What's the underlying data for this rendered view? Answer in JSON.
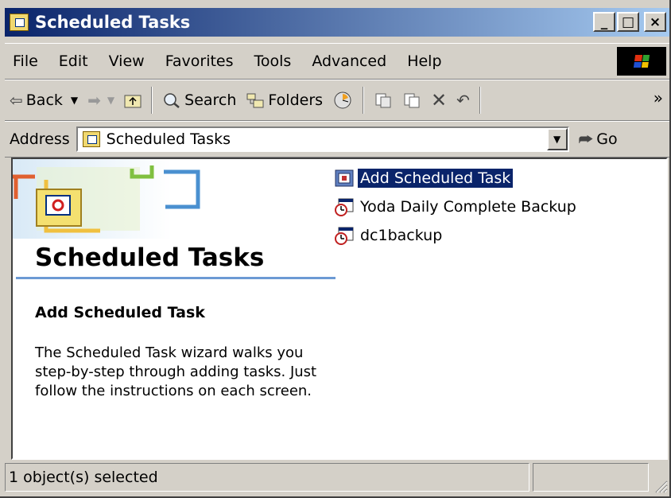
{
  "window": {
    "title": "Scheduled Tasks"
  },
  "caption_buttons": {
    "minimize": "_",
    "maximize": "□",
    "close": "×"
  },
  "menu": [
    "File",
    "Edit",
    "View",
    "Favorites",
    "Tools",
    "Advanced",
    "Help"
  ],
  "toolbar": {
    "back": "Back",
    "search": "Search",
    "folders": "Folders",
    "overflow": "»"
  },
  "address": {
    "label": "Address",
    "value": "Scheduled Tasks",
    "go": "Go"
  },
  "left_panel": {
    "heading": "Scheduled Tasks",
    "item_title": "Add Scheduled Task",
    "description": "The Scheduled Task wizard walks you step-by-step through adding tasks. Just follow the instructions on each screen."
  },
  "files": [
    {
      "label": "Add Scheduled Task",
      "icon": "add-task-icon",
      "selected": true
    },
    {
      "label": "Yoda Daily Complete Backup",
      "icon": "scheduled-task-icon",
      "selected": false
    },
    {
      "label": "dc1backup",
      "icon": "scheduled-task-icon",
      "selected": false
    }
  ],
  "status": {
    "text": "1 object(s) selected"
  },
  "colors": {
    "title_start": "#0a246a",
    "title_end": "#a6caf0",
    "selection": "#0a246a",
    "rule": "#6c9ad4"
  }
}
